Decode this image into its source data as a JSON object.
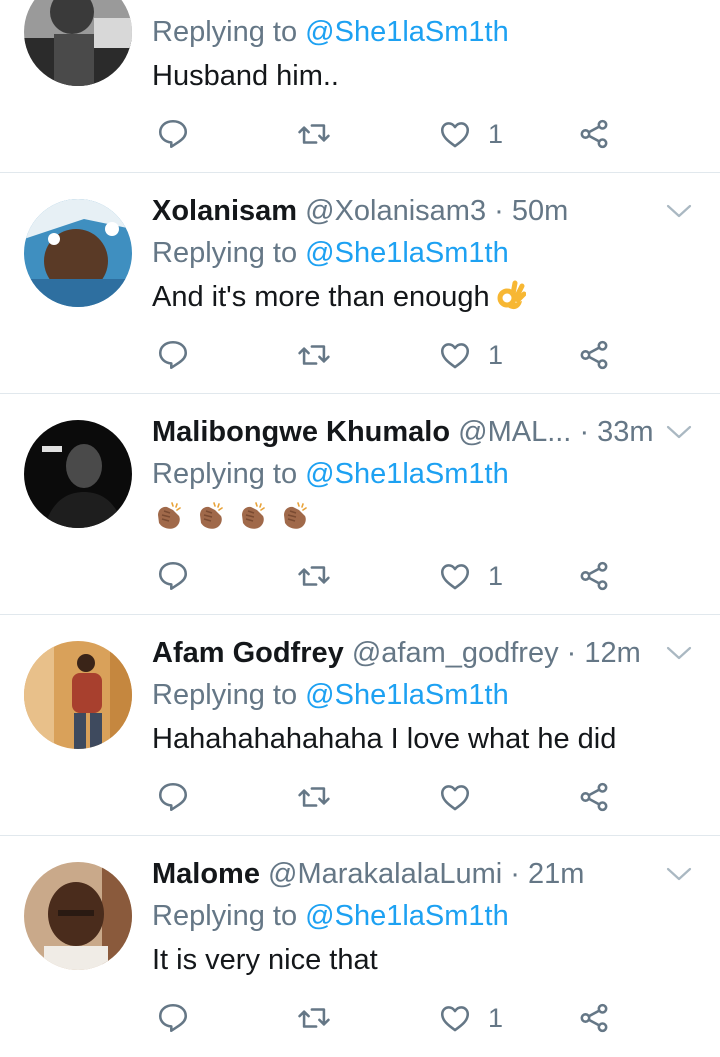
{
  "tweets": [
    {
      "name": "",
      "handle": "",
      "time": "",
      "replying_prefix": "Replying to",
      "replying_to": "@She1laSm1th",
      "text": "Husband him..",
      "like_count": "1",
      "show_header": false
    },
    {
      "name": "Xolanisam",
      "handle": "@Xolanisam3",
      "dot": "·",
      "time": "50m",
      "replying_prefix": "Replying to",
      "replying_to": "@She1laSm1th",
      "text": "And it's more than enough",
      "emoji": "ok-hand-emoji",
      "like_count": "1"
    },
    {
      "name": "Malibongwe Khumalo",
      "handle": "@MAL...",
      "dot": "·",
      "time": "33m",
      "replying_prefix": "Replying to",
      "replying_to": "@She1laSm1th",
      "text": "",
      "emoji": "clapping-hands-emoji",
      "emoji_count": 4,
      "like_count": "1"
    },
    {
      "name": "Afam Godfrey",
      "handle": "@afam_godfrey",
      "dot": "·",
      "time": "12m",
      "replying_prefix": "Replying to",
      "replying_to": "@She1laSm1th",
      "text": "Hahahahahahaha I love what he did",
      "like_count": ""
    },
    {
      "name": "Malome",
      "handle": "@MarakalalaLumi",
      "dot": "·",
      "time": "21m",
      "replying_prefix": "Replying to",
      "replying_to": "@She1laSm1th",
      "text": "It is very nice that",
      "like_count": "1"
    }
  ],
  "icons": {
    "reply": "reply-icon",
    "retweet": "retweet-icon",
    "like": "heart-icon",
    "share": "share-icon",
    "more": "chevron-down-icon"
  },
  "colors": {
    "link": "#1da1f2",
    "secondary_text": "#657786",
    "primary_text": "#14171a",
    "divider": "#e1e8ed"
  }
}
